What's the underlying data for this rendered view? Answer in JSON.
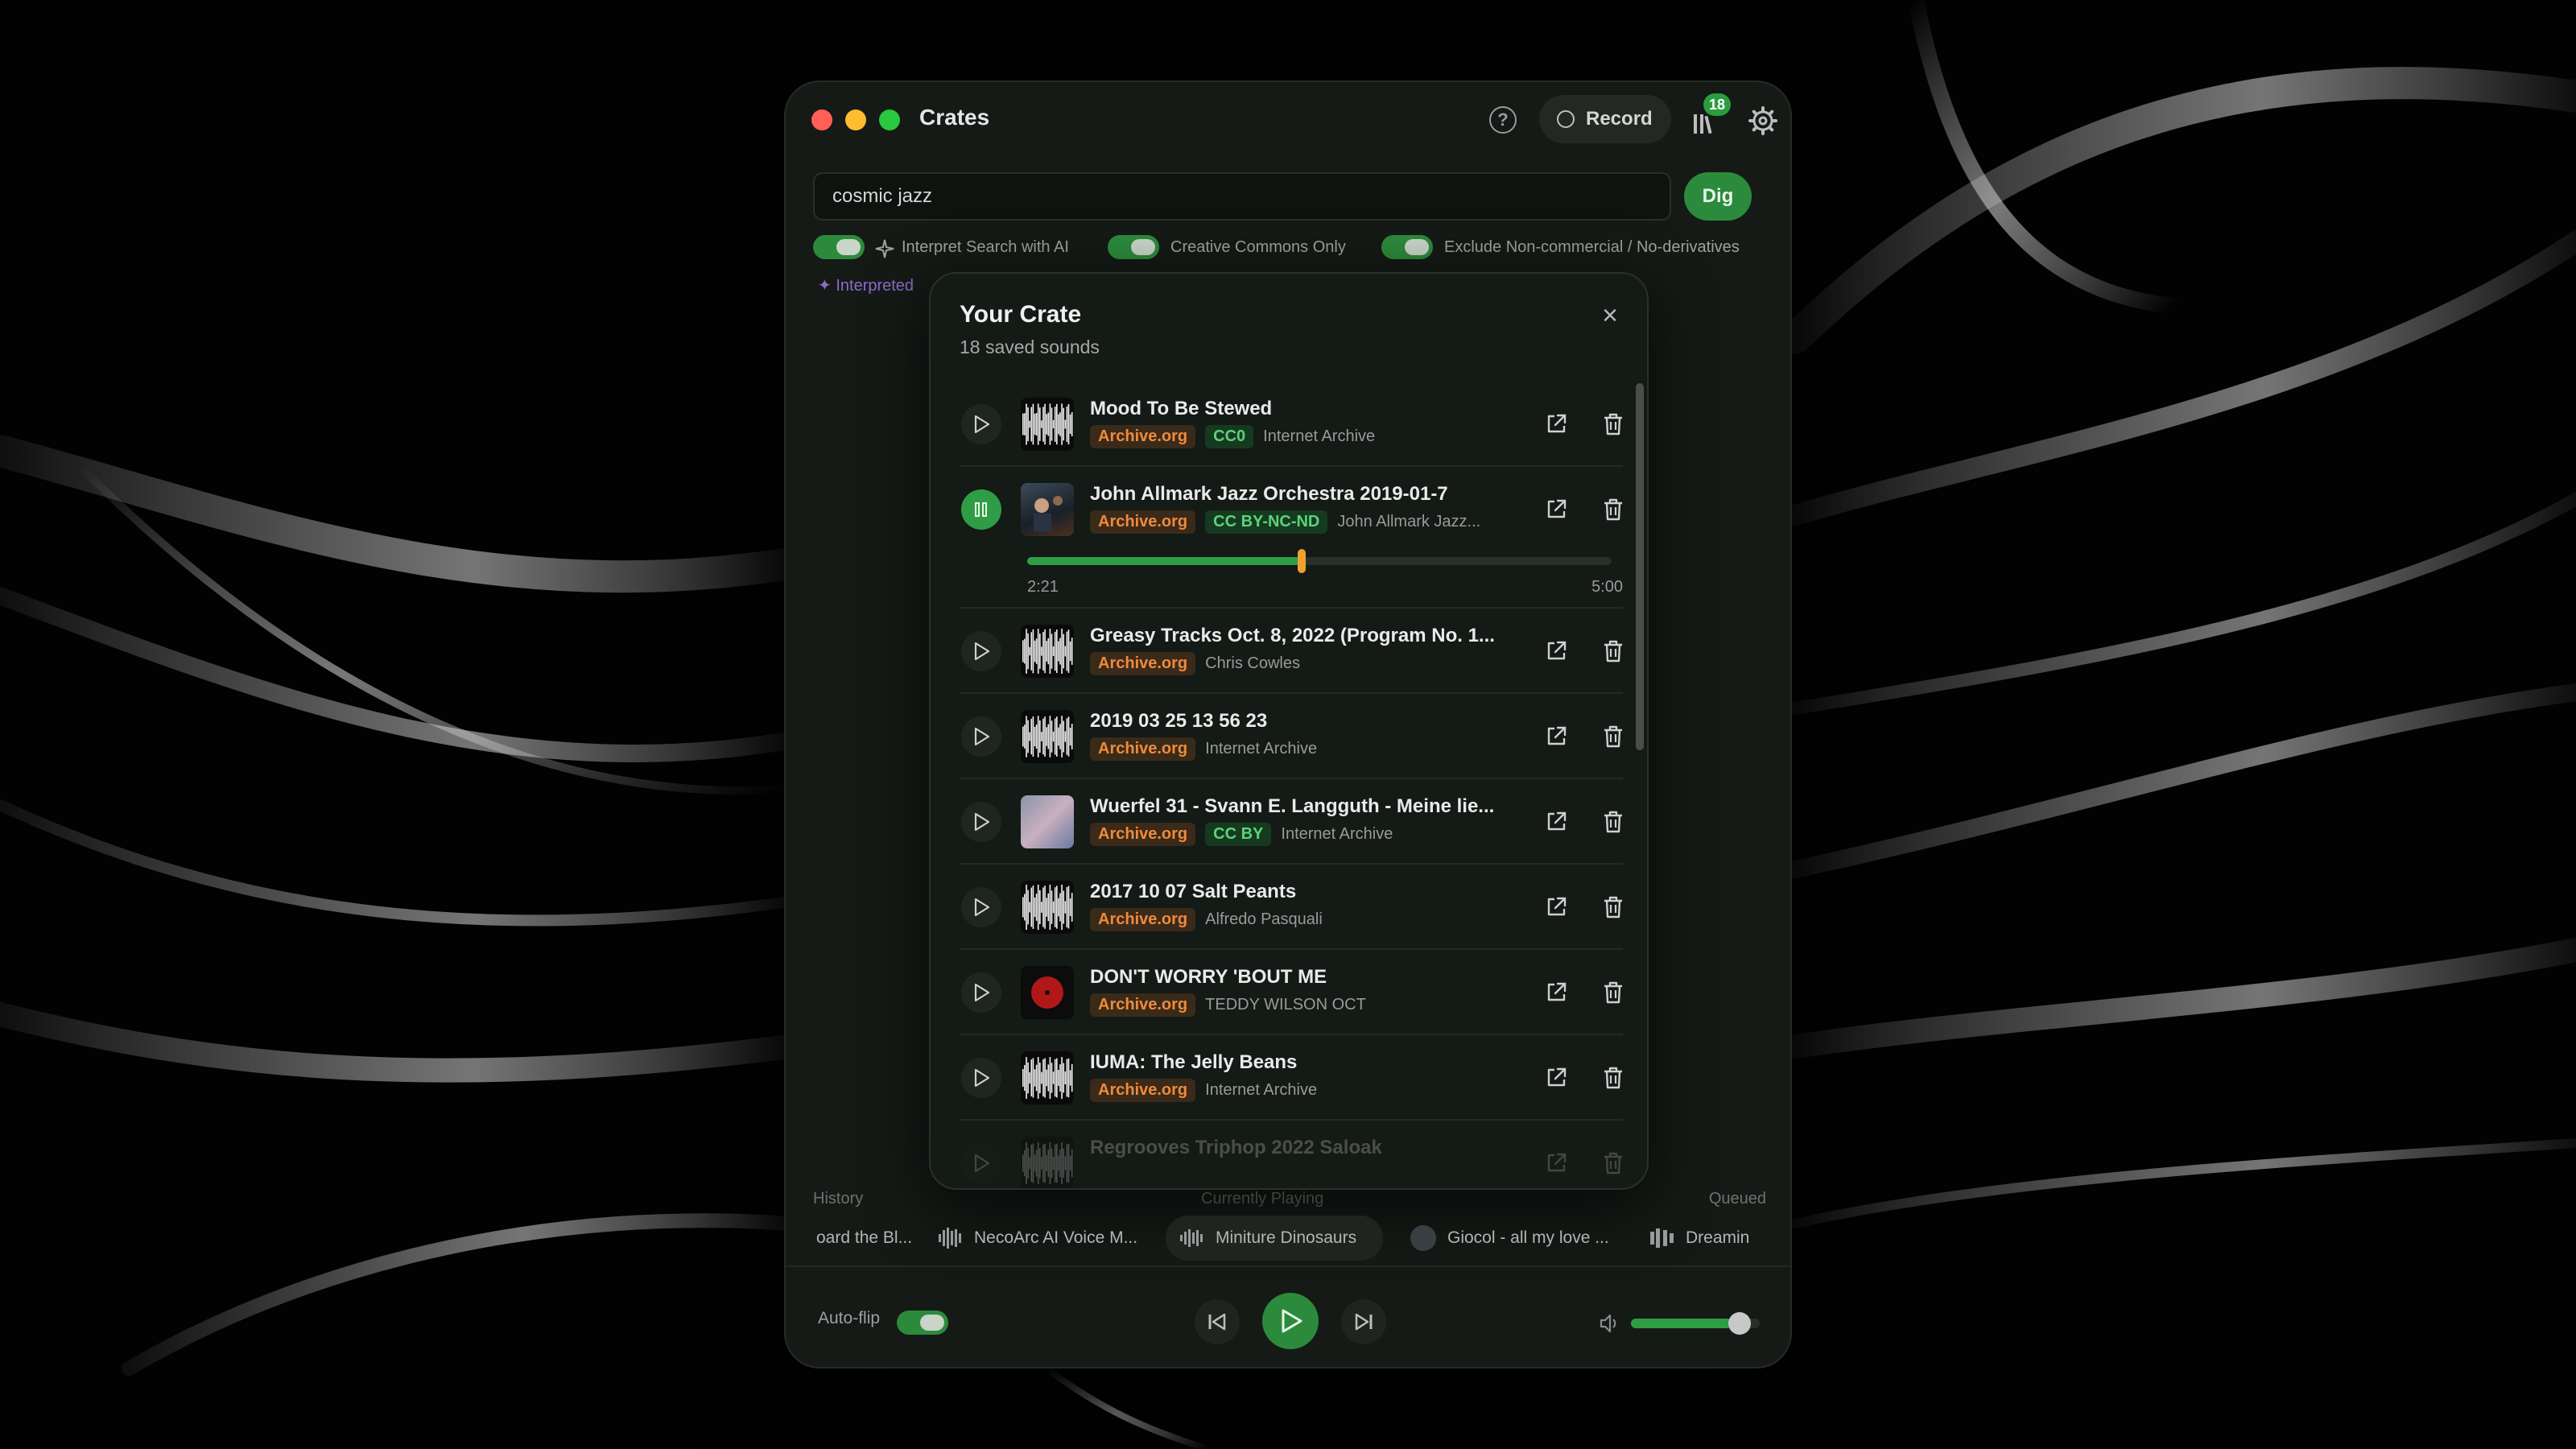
{
  "window": {
    "title": "Crates",
    "record_label": "Record",
    "library_count": "18",
    "colors": {
      "accent": "#2f9d45",
      "source_tag": "#f08a3a",
      "license_tag": "#5bd27a",
      "bg": "#151a16"
    }
  },
  "search": {
    "value": "cosmic jazz",
    "button": "Dig"
  },
  "options": [
    {
      "label": "Interpret Search with AI",
      "on": true
    },
    {
      "label": "Creative Commons Only",
      "on": true
    },
    {
      "label": "Exclude Non-commercial / No-derivatives",
      "on": true
    }
  ],
  "interpreted_label": "Interpreted",
  "crate": {
    "title": "Your Crate",
    "subtitle": "18 saved sounds",
    "items": [
      {
        "title": "Mood To Be Stewed",
        "source": "Archive.org",
        "license": "CC0",
        "author": "Internet Archive",
        "playing": false
      },
      {
        "title": "John Allmark Jazz Orchestra 2019-01-7",
        "source": "Archive.org",
        "license": "CC BY-NC-ND",
        "author": "John Allmark Jazz...",
        "playing": true,
        "elapsed": "2:21",
        "duration": "5:00",
        "progress": 0.47
      },
      {
        "title": "Greasy Tracks Oct. 8, 2022 (Program No. 1...",
        "source": "Archive.org",
        "license": "",
        "author": "Chris Cowles",
        "playing": false
      },
      {
        "title": "2019 03 25 13 56 23",
        "source": "Archive.org",
        "license": "",
        "author": "Internet Archive",
        "playing": false
      },
      {
        "title": "Wuerfel 31 - Svann E. Langguth - Meine lie...",
        "source": "Archive.org",
        "license": "CC BY",
        "author": "Internet Archive",
        "playing": false
      },
      {
        "title": "2017 10 07 Salt Peants",
        "source": "Archive.org",
        "license": "",
        "author": "Alfredo Pasquali",
        "playing": false
      },
      {
        "title": "DON'T WORRY 'BOUT ME",
        "source": "Archive.org",
        "license": "",
        "author": "TEDDY WILSON OCTET",
        "playing": false
      },
      {
        "title": "IUMA: The Jelly Beans",
        "source": "Archive.org",
        "license": "",
        "author": "Internet Archive",
        "playing": false
      },
      {
        "title": "Regrooves Triphop 2022 Saloak",
        "source": "",
        "license": "",
        "author": "",
        "playing": false
      }
    ]
  },
  "queue": {
    "history_label": "History",
    "current_label": "Currently Playing",
    "queued_label": "Queued",
    "chips": [
      "oard the Bl...",
      "NecoArc AI Voice M...",
      "Miniture Dinosaurs",
      "Giocol - all my love ...",
      "Dreamin"
    ]
  },
  "player": {
    "autoflip_label": "Auto-flip",
    "autoflip_on": true,
    "volume": 0.78
  }
}
